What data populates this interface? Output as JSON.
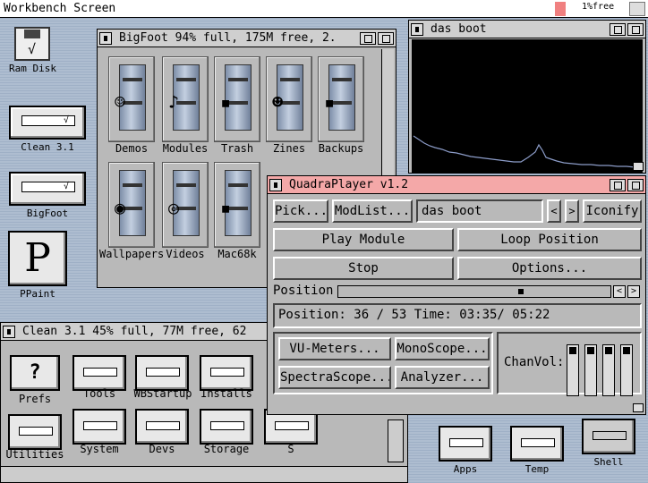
{
  "screen": {
    "title": "Workbench Screen",
    "memory": "1%free"
  },
  "desktop_icons": [
    {
      "label": "Ram Disk",
      "icon": "ram-disk-icon"
    },
    {
      "label": "Clean 3.1",
      "icon": "drawer-icon"
    },
    {
      "label": "BigFoot",
      "icon": "drawer-icon"
    },
    {
      "label": "PPaint",
      "icon": "ppaint-icon",
      "glyph": "P"
    }
  ],
  "bigfoot": {
    "title": "BigFoot  94% full, 175M free, 2.",
    "items": [
      "Demos",
      "Modules",
      "Trash",
      "Zines",
      "Backups",
      "Wallpapers",
      "Videos",
      "Mac68k"
    ]
  },
  "clean": {
    "title": "Clean 3.1  45% full, 77M free, 62",
    "items": [
      "Prefs",
      "Tools",
      "WBStartup",
      "Installs",
      "Utilities",
      "System",
      "Devs",
      "Storage",
      "S"
    ]
  },
  "dasboot": {
    "title": "das boot"
  },
  "player": {
    "title": "QuadraPlayer v1.2",
    "pick": "Pick...",
    "modlist": "ModList...",
    "module_name": "das boot",
    "prev": "<",
    "next": ">",
    "iconify": "Iconify",
    "play": "Play Module",
    "loop": "Loop Position",
    "stop": "Stop",
    "options": "Options...",
    "position_label": "Position",
    "status": "Position: 36 / 53  Time: 03:35/ 05:22",
    "vu": "VU-Meters...",
    "mono": "MonoScope...",
    "spectra": "SpectraScope...",
    "analyzer": "Analyzer...",
    "chanvol": "ChanVol:",
    "channels": 4,
    "position_current": 36,
    "position_total": 53
  },
  "right_icons": [
    {
      "label": "Apps"
    },
    {
      "label": "Temp"
    },
    {
      "label": "Shell"
    }
  ],
  "colors": {
    "accent_title": "#f4a8a8",
    "window_bg": "#b9b9b9",
    "scope_line": "#8c9cc8"
  }
}
